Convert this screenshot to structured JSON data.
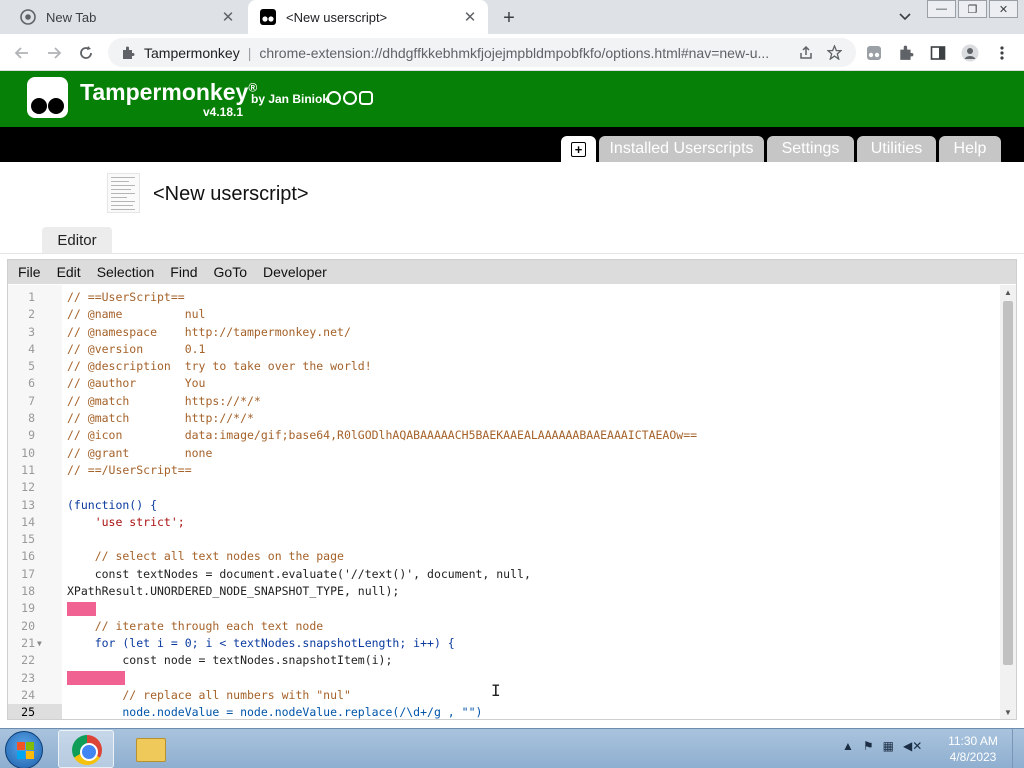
{
  "browser": {
    "tabs": [
      {
        "title": "New Tab",
        "active": false
      },
      {
        "title": "<New userscript>",
        "active": true
      }
    ],
    "site_name": "Tampermonkey",
    "url": "chrome-extension://dhdgffkkebhmkfjojejmpbldmpobfkfo/options.html#nav=new-u...",
    "window_controls": {
      "minimize": "—",
      "restore": "❐",
      "close": "✕"
    }
  },
  "tampermonkey": {
    "brand": "Tampermonkey",
    "registered": "®",
    "by": "by Jan Biniok",
    "version": "v4.18.1",
    "nav_tabs": [
      {
        "label": "Installed Userscripts"
      },
      {
        "label": "Settings"
      },
      {
        "label": "Utilities"
      },
      {
        "label": "Help"
      }
    ],
    "new_script_glyph": "+"
  },
  "script": {
    "title": "<New userscript>",
    "subtab": "Editor"
  },
  "editor": {
    "menu": [
      "File",
      "Edit",
      "Selection",
      "Find",
      "GoTo",
      "Developer"
    ],
    "lines": [
      {
        "n": "1",
        "t": "// ==UserScript=="
      },
      {
        "n": "2",
        "t": "// @name         nul"
      },
      {
        "n": "3",
        "t": "// @namespace    http://tampermonkey.net/"
      },
      {
        "n": "4",
        "t": "// @version      0.1"
      },
      {
        "n": "5",
        "t": "// @description  try to take over the world!"
      },
      {
        "n": "6",
        "t": "// @author       You"
      },
      {
        "n": "7",
        "t": "// @match        https://*/*"
      },
      {
        "n": "8",
        "t": "// @match        http://*/*"
      },
      {
        "n": "9",
        "t": "// @icon         data:image/gif;base64,R0lGODlhAQABAAAAACH5BAEKAAEALAAAAAABAAEAAAICTAEAOw=="
      },
      {
        "n": "10",
        "t": "// @grant        none"
      },
      {
        "n": "11",
        "t": "// ==/UserScript=="
      },
      {
        "n": "12",
        "t": ""
      },
      {
        "n": "13",
        "t": "(function() {"
      },
      {
        "n": "14",
        "t": "    'use strict';"
      },
      {
        "n": "15",
        "t": ""
      },
      {
        "n": "16",
        "t": "    // select all text nodes on the page"
      },
      {
        "n": "17",
        "t": "    const textNodes = document.evaluate('//text()', document, null,"
      },
      {
        "n": "18",
        "t": "XPathResult.UNORDERED_NODE_SNAPSHOT_TYPE, null);"
      },
      {
        "n": "19",
        "t": ""
      },
      {
        "n": "20",
        "t": "    // iterate through each text node"
      },
      {
        "n": "21",
        "t": "    for (let i = 0; i < textNodes.snapshotLength; i++) {"
      },
      {
        "n": "22",
        "t": "        const node = textNodes.snapshotItem(i);"
      },
      {
        "n": "23",
        "t": ""
      },
      {
        "n": "24",
        "t": "        // replace all numbers with \"nul\""
      },
      {
        "n": "25",
        "t": "        node.nodeValue = node.nodeValue.replace(/\\d+/g , \"\")"
      }
    ]
  },
  "taskbar": {
    "time": "11:30 AM",
    "date": "4/8/2023"
  },
  "colors": {
    "tm_green": "#068006",
    "nav_black": "#000000",
    "nav_tab_gray": "#c6c6c6",
    "error_marker": "#f06292"
  }
}
